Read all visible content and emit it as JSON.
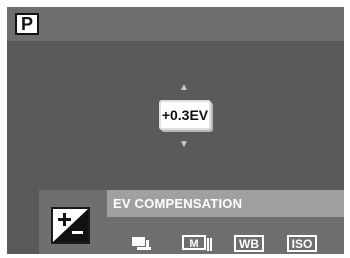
{
  "mode": {
    "label": "P"
  },
  "ev": {
    "value": "+0.3EV"
  },
  "menu": {
    "title": "EV COMPENSATION",
    "items": [
      {
        "name": "ev-compensation",
        "icon": "ev-compensation-icon",
        "selected": true
      },
      {
        "name": "drive-mode",
        "icon": "continuous-shooting-icon"
      },
      {
        "name": "photometry",
        "icon": "m-photometry-icon",
        "label": "M"
      },
      {
        "name": "white-balance",
        "icon": "white-balance-icon",
        "label": "WB"
      },
      {
        "name": "iso",
        "icon": "iso-icon",
        "label": "ISO"
      }
    ]
  },
  "colors": {
    "screen": "#5a5a5a",
    "panel": "#6f6f6f",
    "title_bar": "#a0a0a0"
  }
}
